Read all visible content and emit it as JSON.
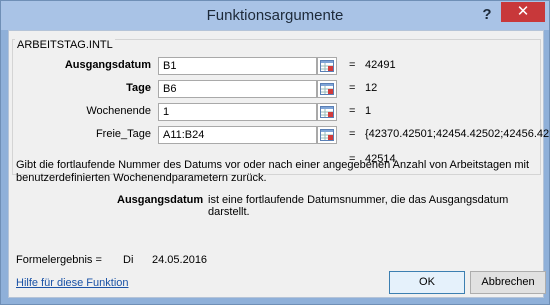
{
  "window": {
    "title": "Funktionsargumente",
    "help_glyph": "?",
    "close_glyph": "✕"
  },
  "function_name": "ARBEITSTAG.INTL",
  "arguments": [
    {
      "label": "Ausgangsdatum",
      "value": "B1",
      "result": "42491",
      "bold": true
    },
    {
      "label": "Tage",
      "value": "B6",
      "result": "12",
      "bold": true
    },
    {
      "label": "Wochenende",
      "value": "1",
      "result": "1",
      "bold": false
    },
    {
      "label": "Freie_Tage",
      "value": "A11:B24",
      "result": "{42370.42501;42454.42502;42456.42...",
      "bold": false
    }
  ],
  "equals": "=",
  "function_result": "42514",
  "description": "Gibt die fortlaufende Nummer des Datums vor oder nach einer angegebenen Anzahl von Arbeitstagen mit benutzerdefinierten Wochenendparametern zurück.",
  "arg_help": {
    "name": "Ausgangsdatum",
    "text": "ist eine fortlaufende Datumsnummer, die das Ausgangsdatum darstellt."
  },
  "formula_result": {
    "label": "Formelergebnis =",
    "day": "Di",
    "date": "24.05.2016"
  },
  "help_link": "Hilfe für diese Funktion",
  "buttons": {
    "ok": "OK",
    "cancel": "Abbrechen"
  }
}
